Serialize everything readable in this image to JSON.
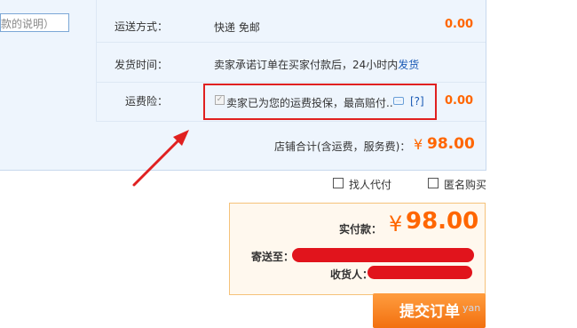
{
  "panel": {
    "note_field_value": "款的说明）",
    "rows": [
      {
        "label": "运送方式：",
        "value": "快递 免邮",
        "price": "0.00"
      },
      {
        "label": "发货时间：",
        "value": "卖家承诺订单在买家付款后，24小时内",
        "link": "发货"
      },
      {
        "label": "运费险：",
        "value": "卖家已为您的运费投保，最高赔付..",
        "help": "[?]",
        "price": "0.00"
      }
    ],
    "shop_total_label": "店铺合计(含运费，服务费)：",
    "currency": "¥",
    "shop_total_value": "98.00"
  },
  "options": {
    "proxy_pay": "找人代付",
    "anonymous": "匿名购买"
  },
  "summary": {
    "paid_label": "实付款：",
    "currency": "¥",
    "paid_value": "98.00",
    "ship_to_label": "寄送至：",
    "receiver_label": "收货人："
  },
  "submit_label": "提交订单",
  "watermark": "yan",
  "colors": {
    "accent_orange": "#ff6600",
    "annotation_red": "#e02020",
    "panel_bg": "#eef5fd",
    "link_blue": "#1a5ab5"
  }
}
